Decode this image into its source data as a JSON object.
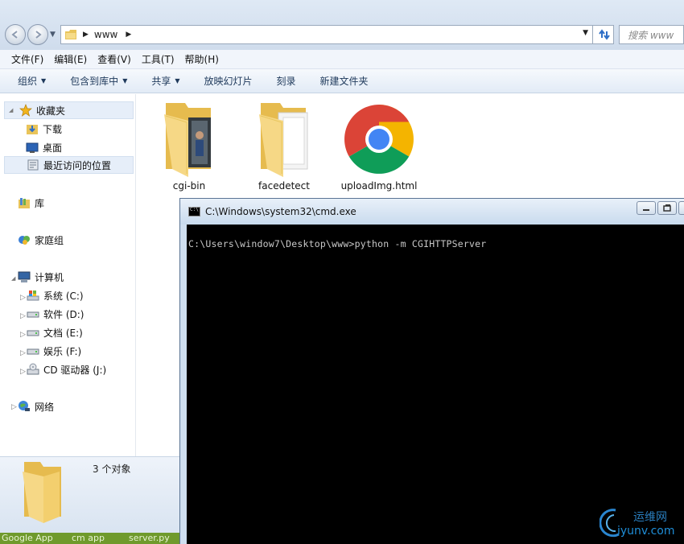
{
  "address": {
    "crumb": "www",
    "search_placeholder": "搜索 www"
  },
  "menu": [
    "文件(F)",
    "编辑(E)",
    "查看(V)",
    "工具(T)",
    "帮助(H)"
  ],
  "commands": [
    {
      "label": "组织",
      "dropdown": true
    },
    {
      "label": "包含到库中",
      "dropdown": true
    },
    {
      "label": "共享",
      "dropdown": true
    },
    {
      "label": "放映幻灯片",
      "dropdown": false
    },
    {
      "label": "刻录",
      "dropdown": false
    },
    {
      "label": "新建文件夹",
      "dropdown": false
    }
  ],
  "sidebar": {
    "favorites": "收藏夹",
    "downloads": "下载",
    "desktop": "桌面",
    "recent": "最近访问的位置",
    "libraries": "库",
    "homegroup": "家庭组",
    "computer": "计算机",
    "drives": [
      "系统 (C:)",
      "软件 (D:)",
      "文档 (E:)",
      "娱乐 (F:)",
      "CD 驱动器 (J:)"
    ],
    "network": "网络"
  },
  "files": [
    {
      "name": "cgi-bin",
      "icon": "folder-with-photo-icon"
    },
    {
      "name": "facedetect",
      "icon": "folder-with-documents-icon"
    },
    {
      "name": "uploadImg.html",
      "icon": "chrome-icon"
    }
  ],
  "details": {
    "count_text": "3 个对象"
  },
  "cmd": {
    "title": "C:\\Windows\\system32\\cmd.exe",
    "line": "C:\\Users\\window7\\Desktop\\www>python -m CGIHTTPServer"
  },
  "taskbar": [
    "Google App",
    "cm app",
    "server.py"
  ],
  "watermark": {
    "cn": "运维网",
    "url": "iyunv.com"
  },
  "colors": {
    "cmd_bg": "#000000",
    "cmd_text": "#c8c8c8",
    "taskbar": "#6f9a2c",
    "chrome_red": "#db4437",
    "chrome_green": "#0f9d58",
    "chrome_yellow": "#f4b400",
    "chrome_blue": "#4285f4"
  }
}
